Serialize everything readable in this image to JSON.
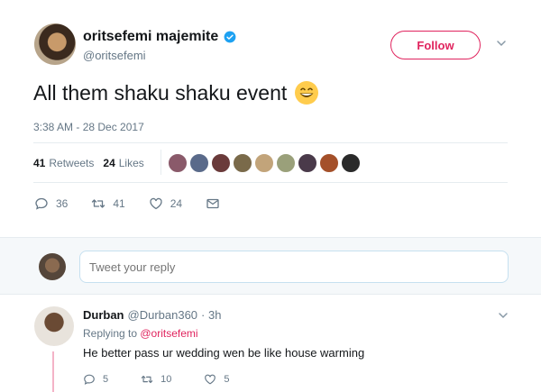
{
  "tweet": {
    "display_name": "oritsefemi majemite",
    "handle": "@oritsefemi",
    "follow_label": "Follow",
    "text": "All them shaku shaku event",
    "emoji": "grinning-face-emoji",
    "timestamp": "3:38 AM - 28 Dec 2017",
    "retweets_count": "41",
    "retweets_label": "Retweets",
    "likes_count": "24",
    "likes_label": "Likes",
    "actions": {
      "reply_count": "36",
      "retweet_count": "41",
      "like_count": "24"
    }
  },
  "reply_box": {
    "placeholder": "Tweet your reply"
  },
  "reply": {
    "name": "Durban",
    "handle": "@Durban360",
    "time": "· 3h",
    "replying_to_prefix": "Replying to ",
    "replying_to_mention": "@oritsefemi",
    "text": "He better pass ur wedding wen be like house warming",
    "actions": {
      "reply_count": "5",
      "retweet_count": "10",
      "like_count": "5"
    }
  },
  "colors": {
    "accent": "#e0245e",
    "verified": "#1da1f2",
    "muted": "#657786",
    "text": "#14171a"
  }
}
